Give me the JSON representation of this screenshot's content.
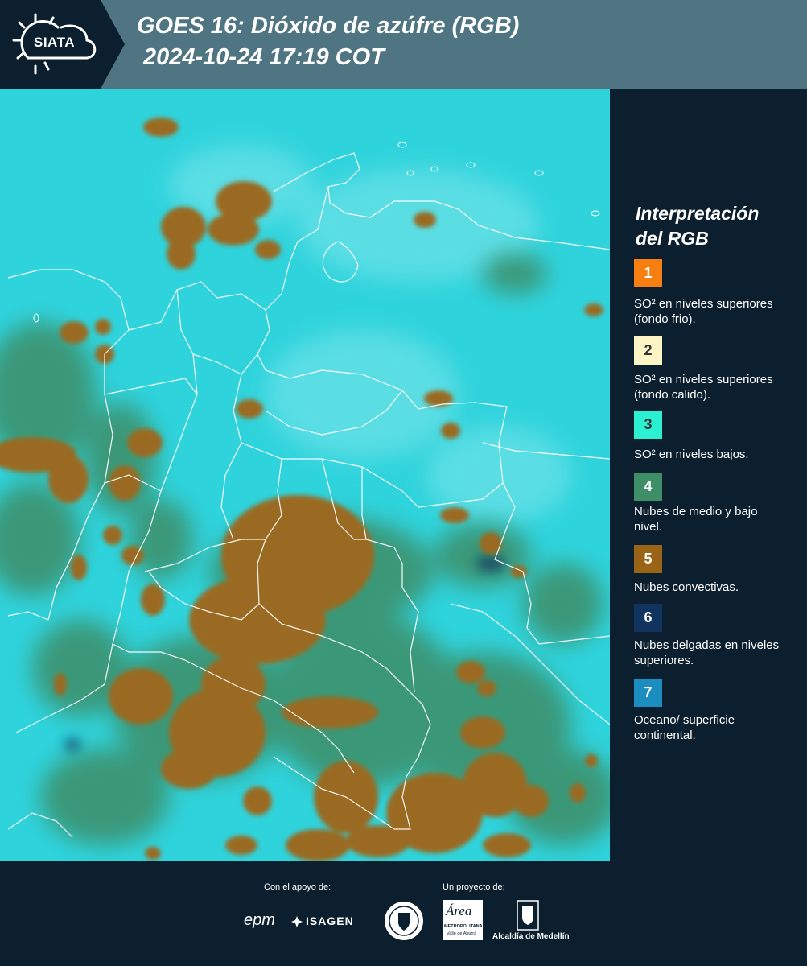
{
  "header": {
    "logo_text": "SIATA",
    "title_line1": "GOES 16: Dióxido de azúfre (RGB)",
    "title_line2": "2024-10-24 17:19 COT"
  },
  "legend": {
    "title_line1": "Interpretación",
    "title_line2": "del RGB",
    "items": [
      {
        "num": "1",
        "color": "#f77f12",
        "num_color": "#ffffff",
        "text": "SO² en niveles superiores (fondo frio)."
      },
      {
        "num": "2",
        "color": "#fdf5c5",
        "num_color": "#333333",
        "text": "SO² en niveles superiores (fondo calido)."
      },
      {
        "num": "3",
        "color": "#2bf0d2",
        "num_color": "#333333",
        "text": "SO² en niveles bajos."
      },
      {
        "num": "4",
        "color": "#3e8e67",
        "num_color": "#ffffff",
        "text": "Nubes de medio y bajo nivel."
      },
      {
        "num": "5",
        "color": "#9a6416",
        "num_color": "#ffffff",
        "text": "Nubes convectivas."
      },
      {
        "num": "6",
        "color": "#11335f",
        "num_color": "#ffffff",
        "text": "Nubes delgadas en niveles superiores."
      },
      {
        "num": "7",
        "color": "#1c8dbf",
        "num_color": "#ffffff",
        "text": "Oceano/ superficie continental."
      }
    ]
  },
  "footer": {
    "support_label": "Con el apoyo de:",
    "project_label": "Un proyecto de:",
    "sponsor1": "epm",
    "sponsor2": "ISAGEN",
    "area_name": "Área",
    "area_sub1": "METROPOLITANA",
    "area_sub2": "Valle de Aburrá",
    "alcaldia": "Alcaldía de Medellín"
  },
  "colors": {
    "background": "#0b1f2e",
    "header": "#4f7482",
    "map_cyan": "#2fd3dc",
    "cloud_brown": "#9a6a22",
    "cloud_green": "#3e8e67"
  }
}
